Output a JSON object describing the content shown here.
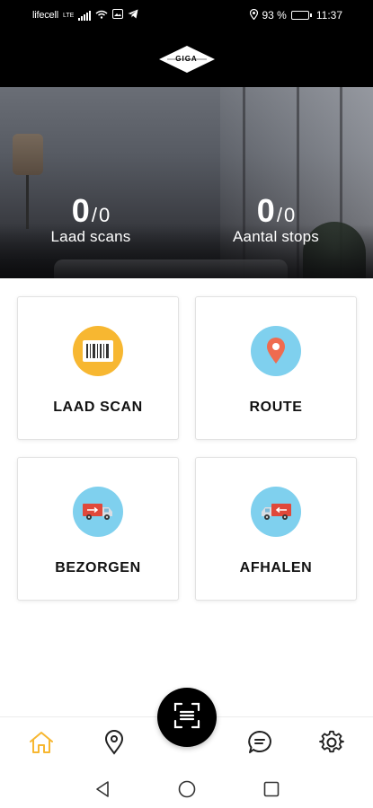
{
  "status_bar": {
    "carrier": "lifecell",
    "network": "LTE",
    "battery_percent": "93 %",
    "battery_level": 0.93,
    "time": "11:37"
  },
  "header": {
    "logo_text": "GIGA"
  },
  "stats": [
    {
      "value": "0",
      "separator": "/",
      "total": "0",
      "label": "Laad scans"
    },
    {
      "value": "0",
      "separator": "/",
      "total": "0",
      "label": "Aantal stops"
    }
  ],
  "tiles": [
    {
      "label": "LAAD SCAN",
      "icon": "barcode-icon",
      "color": "#f7b731"
    },
    {
      "label": "ROUTE",
      "icon": "map-pin-icon",
      "color": "#7fd0ee"
    },
    {
      "label": "BEZORGEN",
      "icon": "delivery-truck-icon",
      "color": "#7fd0ee"
    },
    {
      "label": "AFHALEN",
      "icon": "pickup-truck-icon",
      "color": "#7fd0ee"
    }
  ],
  "bottom_nav": {
    "items": [
      {
        "name": "home",
        "icon": "home-icon",
        "active": true
      },
      {
        "name": "map",
        "icon": "location-pin-icon",
        "active": false
      },
      {
        "name": "chat",
        "icon": "chat-bubble-icon",
        "active": false
      },
      {
        "name": "settings",
        "icon": "gear-icon",
        "active": false
      }
    ],
    "scan_button_icon": "scan-frame-icon",
    "active_color": "#f7b731"
  },
  "system_nav": [
    "back-icon",
    "home-circle-icon",
    "recents-icon"
  ]
}
